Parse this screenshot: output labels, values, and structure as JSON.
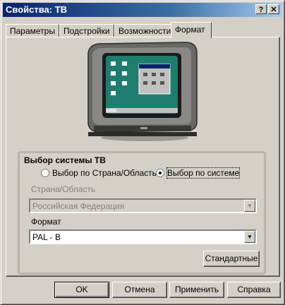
{
  "window": {
    "title": "Свойства: ТВ",
    "help_button": "?",
    "close_button": "✕"
  },
  "tabs": [
    {
      "label": "Параметры"
    },
    {
      "label": "Подстройки"
    },
    {
      "label": "Возможности"
    },
    {
      "label": "Формат",
      "active": true
    }
  ],
  "group": {
    "title": "Выбор системы ТВ",
    "radio_country": "Выбор по Страна/Область",
    "radio_system": "Выбор по системе",
    "selected": "radio_system"
  },
  "country": {
    "label": "Страна/Область",
    "value": "Российская Федерация"
  },
  "format": {
    "label": "Формат",
    "value": "PAL - B"
  },
  "buttons": {
    "standard": "Стандартные",
    "ok": "OK",
    "cancel": "Отмена",
    "apply": "Применить",
    "help": "Справка"
  }
}
